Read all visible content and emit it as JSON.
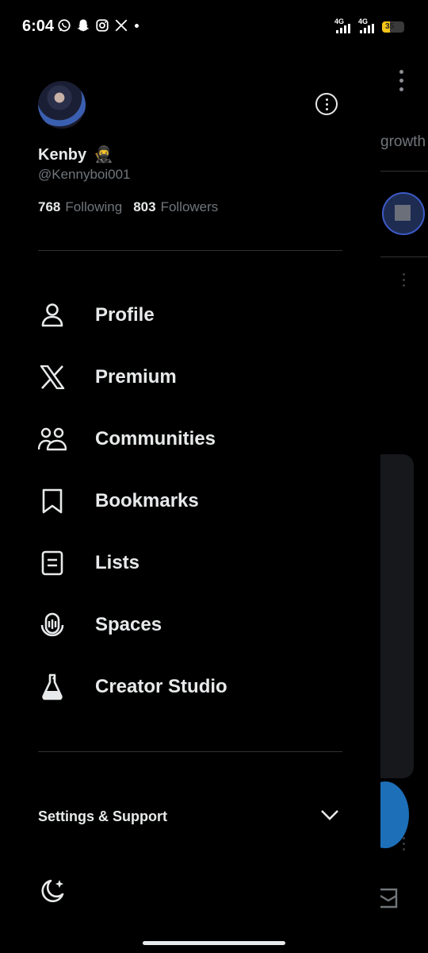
{
  "status_bar": {
    "time": "6:04",
    "notification_icons": [
      "whatsapp-icon",
      "snapchat-icon",
      "instagram-icon",
      "x-icon",
      "dot-icon"
    ],
    "network_1": "4G",
    "network_2": "4G",
    "battery_percent": "35",
    "battery_level": 0.35
  },
  "profile": {
    "display_name": "Kenby",
    "name_emoji": "🥷",
    "handle": "@Kennyboi001",
    "following_count": "768",
    "following_label": "Following",
    "followers_count": "803",
    "followers_label": "Followers"
  },
  "menu": {
    "items": [
      {
        "label": "Profile",
        "icon": "person-icon"
      },
      {
        "label": "Premium",
        "icon": "x-logo-icon"
      },
      {
        "label": "Communities",
        "icon": "communities-icon"
      },
      {
        "label": "Bookmarks",
        "icon": "bookmark-icon"
      },
      {
        "label": "Lists",
        "icon": "list-icon"
      },
      {
        "label": "Spaces",
        "icon": "spaces-icon"
      },
      {
        "label": "Creator Studio",
        "icon": "flask-icon"
      }
    ]
  },
  "settings": {
    "label": "Settings & Support"
  },
  "background": {
    "tab_partial": "growth"
  },
  "colors": {
    "background": "#000000",
    "text_primary": "#e7e9ea",
    "text_secondary": "#71767b",
    "divider": "#2f3336",
    "accent": "#1d9bf0",
    "battery": "#f5c518"
  }
}
